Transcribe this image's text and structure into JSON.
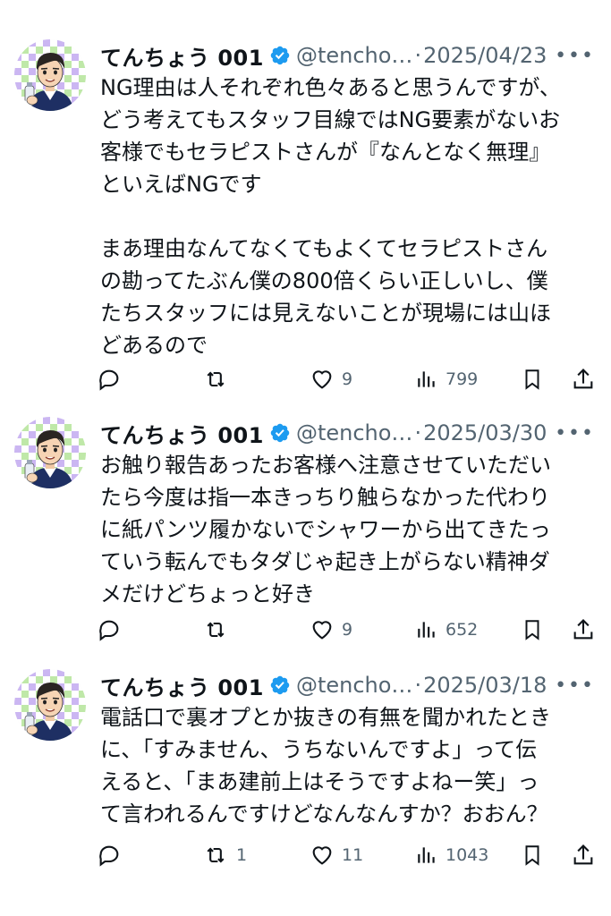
{
  "tweets": [
    {
      "display_name": "てんちょう 001",
      "handle": "@tencho…",
      "dot": "·",
      "date": "2025/04/23",
      "text": "NG理由は人それぞれ色々あると思うんですが、\nどう考えてもスタッフ目線ではNG要素がないお\n客様でもセラピストさんが『なんとなく無理』\nといえばNGです\n\nまあ理由なんてなくてもよくてセラピストさん\nの勘ってたぶん僕の800倍くらい正しいし、僕\nたちスタッフには見えないことが現場には山ほ\nどあるので",
      "replies": "",
      "retweets": "",
      "likes": "9",
      "views": "799"
    },
    {
      "display_name": "てんちょう 001",
      "handle": "@tencho…",
      "dot": "·",
      "date": "2025/03/30",
      "text": "お触り報告あったお客様へ注意させていただい\nたら今度は指一本きっちり触らなかった代わり\nに紙パンツ履かないでシャワーから出てきたっ\nていう転んでもタダじゃ起き上がらない精神ダ\nメだけどちょっと好き",
      "replies": "",
      "retweets": "",
      "likes": "9",
      "views": "652"
    },
    {
      "display_name": "てんちょう 001",
      "handle": "@tencho…",
      "dot": "·",
      "date": "2025/03/18",
      "text": "電話口で裏オプとか抜きの有無を聞かれたとき\nに、「すみません、うちないんですよ」って伝\nえると、「まあ建前上はそうですよねー笑」っ\nて言われるんですけどなんなんすか？おおん？",
      "replies": "",
      "retweets": "1",
      "likes": "11",
      "views": "1043"
    }
  ],
  "icons": {
    "more": "more-dots-icon",
    "reply": "reply-icon",
    "retweet": "retweet-icon",
    "like": "heart-icon",
    "views": "views-icon",
    "bookmark": "bookmark-icon",
    "share": "share-icon",
    "verified": "verified-badge-icon"
  },
  "colors": {
    "text": "#0f1419",
    "muted": "#536471",
    "verified": "#1d9bf0"
  }
}
